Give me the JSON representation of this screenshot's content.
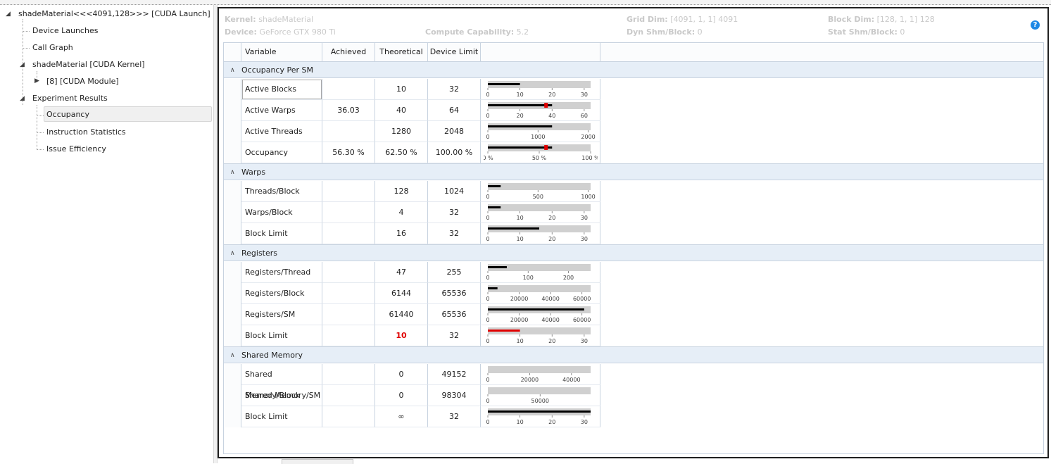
{
  "tree": {
    "items": [
      {
        "label": "shadeMaterial<<<4091,128>>> [CUDA Launch]",
        "expander": "◢"
      },
      {
        "label": "Device Launches"
      },
      {
        "label": "Call Graph"
      },
      {
        "label": "shadeMaterial [CUDA Kernel]",
        "expander": "◢"
      },
      {
        "label": "[8] [CUDA Module]",
        "expander": "▶"
      },
      {
        "label": "Experiment Results",
        "expander": "◢"
      },
      {
        "label": "Occupancy"
      },
      {
        "label": "Instruction Statistics"
      },
      {
        "label": "Issue Efficiency"
      }
    ]
  },
  "header": {
    "kernel_label": "Kernel:",
    "kernel_value": "shadeMaterial",
    "device_label": "Device:",
    "device_value": "GeForce GTX 980 Ti",
    "cc_label": "Compute Capability:",
    "cc_value": "5.2",
    "grid_label": "Grid Dim:",
    "grid_value": "[4091, 1, 1] 4091",
    "dyn_label": "Dyn Shm/Block:",
    "dyn_value": "0",
    "block_label": "Block Dim:",
    "block_value": "[128, 1, 1] 128",
    "stat_label": "Stat Shm/Block:",
    "stat_value": "0",
    "help_icon": "?"
  },
  "columns": {
    "variable": "Variable",
    "achieved": "Achieved",
    "theoretical": "Theoretical",
    "device_limit": "Device Limit"
  },
  "colors": {
    "bar_bg": "#d0d0d0",
    "bar_fg": "#000000",
    "marker": "#e00000",
    "limit_red": "#e00000"
  },
  "sections": [
    {
      "title": "Occupancy Per SM",
      "rows": [
        {
          "variable": "Active Blocks",
          "achieved": "",
          "theoretical": "10",
          "device_limit": "32",
          "bar": {
            "max": 32,
            "value": 10,
            "ticks": [
              "0",
              "10",
              "20",
              "30"
            ],
            "tick_values": [
              0,
              10,
              20,
              30
            ]
          }
        },
        {
          "variable": "Active Warps",
          "achieved": "36.03",
          "theoretical": "40",
          "device_limit": "64",
          "bar": {
            "max": 64,
            "value": 40,
            "marker": 36.03,
            "ticks": [
              "0",
              "20",
              "40",
              "60"
            ],
            "tick_values": [
              0,
              20,
              40,
              60
            ]
          }
        },
        {
          "variable": "Active Threads",
          "achieved": "",
          "theoretical": "1280",
          "device_limit": "2048",
          "bar": {
            "max": 2048,
            "value": 1280,
            "ticks": [
              "0",
              "1000",
              "2000"
            ],
            "tick_values": [
              0,
              1000,
              2000
            ]
          }
        },
        {
          "variable": "Occupancy",
          "achieved": "56.30 %",
          "theoretical": "62.50 %",
          "device_limit": "100.00 %",
          "bar": {
            "max": 100,
            "value": 62.5,
            "marker": 56.3,
            "ticks": [
              "0 %",
              "50 %",
              "100 %"
            ],
            "tick_values": [
              0,
              50,
              100
            ]
          }
        }
      ]
    },
    {
      "title": "Warps",
      "rows": [
        {
          "variable": "Threads/Block",
          "achieved": "",
          "theoretical": "128",
          "device_limit": "1024",
          "bar": {
            "max": 1024,
            "value": 128,
            "ticks": [
              "0",
              "500",
              "1000"
            ],
            "tick_values": [
              0,
              500,
              1000
            ]
          }
        },
        {
          "variable": "Warps/Block",
          "achieved": "",
          "theoretical": "4",
          "device_limit": "32",
          "bar": {
            "max": 32,
            "value": 4,
            "ticks": [
              "0",
              "10",
              "20",
              "30"
            ],
            "tick_values": [
              0,
              10,
              20,
              30
            ]
          }
        },
        {
          "variable": "Block Limit",
          "achieved": "",
          "theoretical": "16",
          "device_limit": "32",
          "bar": {
            "max": 32,
            "value": 16,
            "ticks": [
              "0",
              "10",
              "20",
              "30"
            ],
            "tick_values": [
              0,
              10,
              20,
              30
            ]
          }
        }
      ]
    },
    {
      "title": "Registers",
      "rows": [
        {
          "variable": "Registers/Thread",
          "achieved": "",
          "theoretical": "47",
          "device_limit": "255",
          "bar": {
            "max": 255,
            "value": 47,
            "ticks": [
              "0",
              "100",
              "200"
            ],
            "tick_values": [
              0,
              100,
              200
            ]
          }
        },
        {
          "variable": "Registers/Block",
          "achieved": "",
          "theoretical": "6144",
          "device_limit": "65536",
          "bar": {
            "max": 65536,
            "value": 6144,
            "ticks": [
              "0",
              "20000",
              "40000",
              "60000"
            ],
            "tick_values": [
              0,
              20000,
              40000,
              60000
            ]
          }
        },
        {
          "variable": "Registers/SM",
          "achieved": "",
          "theoretical": "61440",
          "device_limit": "65536",
          "bar": {
            "max": 65536,
            "value": 61440,
            "ticks": [
              "0",
              "20000",
              "40000",
              "60000"
            ],
            "tick_values": [
              0,
              20000,
              40000,
              60000
            ]
          }
        },
        {
          "variable": "Block Limit",
          "achieved": "",
          "theoretical": "10",
          "device_limit": "32",
          "limiting": true,
          "bar": {
            "max": 32,
            "value": 10,
            "red": true,
            "ticks": [
              "0",
              "10",
              "20",
              "30"
            ],
            "tick_values": [
              0,
              10,
              20,
              30
            ]
          }
        }
      ]
    },
    {
      "title": "Shared Memory",
      "rows": [
        {
          "variable": "Shared Memory/Block",
          "achieved": "",
          "theoretical": "0",
          "device_limit": "49152",
          "bar": {
            "max": 49152,
            "value": 0,
            "ticks": [
              "0",
              "20000",
              "40000"
            ],
            "tick_values": [
              0,
              20000,
              40000
            ]
          }
        },
        {
          "variable": "Shared Memory/SM",
          "achieved": "",
          "theoretical": "0",
          "device_limit": "98304",
          "bar": {
            "max": 98304,
            "value": 0,
            "ticks": [
              "0",
              "50000"
            ],
            "tick_values": [
              0,
              50000
            ]
          }
        },
        {
          "variable": "Block Limit",
          "achieved": "",
          "theoretical": "∞",
          "device_limit": "32",
          "bar": {
            "max": 32,
            "value": 32,
            "ticks": [
              "0",
              "10",
              "20",
              "30"
            ],
            "tick_values": [
              0,
              10,
              20,
              30
            ]
          }
        }
      ]
    }
  ]
}
